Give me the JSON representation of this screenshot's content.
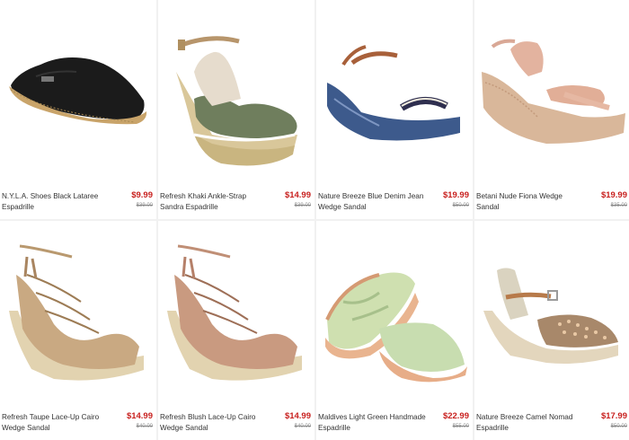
{
  "products": [
    {
      "name": "N.Y.L.A. Shoes Black Lataree Espadrille",
      "price": "$9.99",
      "original_price": "$39.00",
      "image": "black-espadrille-flat"
    },
    {
      "name": "Refresh Khaki Ankle-Strap Sandra Espadrille",
      "price": "$14.99",
      "original_price": "$39.00",
      "image": "khaki-ankle-strap-wedge"
    },
    {
      "name": "Nature Breeze Blue Denim Jean Wedge Sandal",
      "price": "$19.99",
      "original_price": "$50.00",
      "image": "denim-wedge-sandal"
    },
    {
      "name": "Betani Nude Fiona Wedge Sandal",
      "price": "$19.99",
      "original_price": "$35.00",
      "image": "nude-platform-wedge"
    },
    {
      "name": "Refresh Taupe Lace-Up Cairo Wedge Sandal",
      "price": "$14.99",
      "original_price": "$40.00",
      "image": "taupe-lace-up-wedge"
    },
    {
      "name": "Refresh Blush Lace-Up Cairo Wedge Sandal",
      "price": "$14.99",
      "original_price": "$40.00",
      "image": "blush-lace-up-wedge"
    },
    {
      "name": "Maldives Light Green Handmade Espadrille",
      "price": "$22.99",
      "original_price": "$55.00",
      "image": "green-espadrille-pair"
    },
    {
      "name": "Nature Breeze Camel Nomad Espadrille",
      "price": "$17.99",
      "original_price": "$50.00",
      "image": "camel-studded-espadrille"
    }
  ],
  "colors": {
    "price": "#c8201e",
    "original_price": "#888888",
    "name": "#333333"
  }
}
